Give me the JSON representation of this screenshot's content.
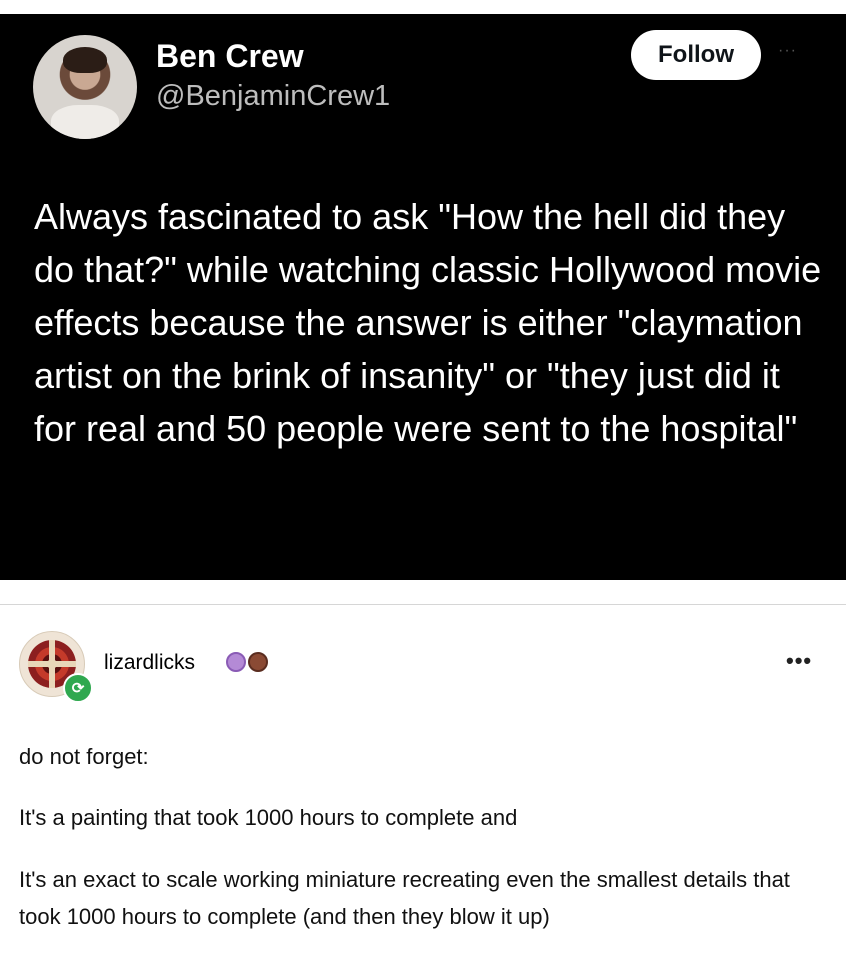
{
  "tweet": {
    "display_name": "Ben Crew",
    "handle": "@BenjaminCrew1",
    "follow_label": "Follow",
    "more_label": "···",
    "text": "Always fascinated to ask \"How the hell did they do that?\" while watching classic Hollywood movie effects because the answer is either \"claymation artist on the brink of insanity\" or \"they just did it for real and 50 people were sent to the hospital\""
  },
  "post": {
    "username": "lizardlicks",
    "more_label": "•••",
    "paragraphs": [
      "do not forget:",
      "It's a painting that took 1000 hours to complete and",
      "It's an exact to scale working miniature recreating even the smallest details that took 1000 hours to complete (and then they blow it up)"
    ],
    "badge_colors": [
      "#b48ad6",
      "#8a4a34"
    ],
    "reblog_icon": "reblog-icon"
  },
  "colors": {
    "tweet_background": "#000000",
    "reblog_badge": "#2fa84f"
  }
}
